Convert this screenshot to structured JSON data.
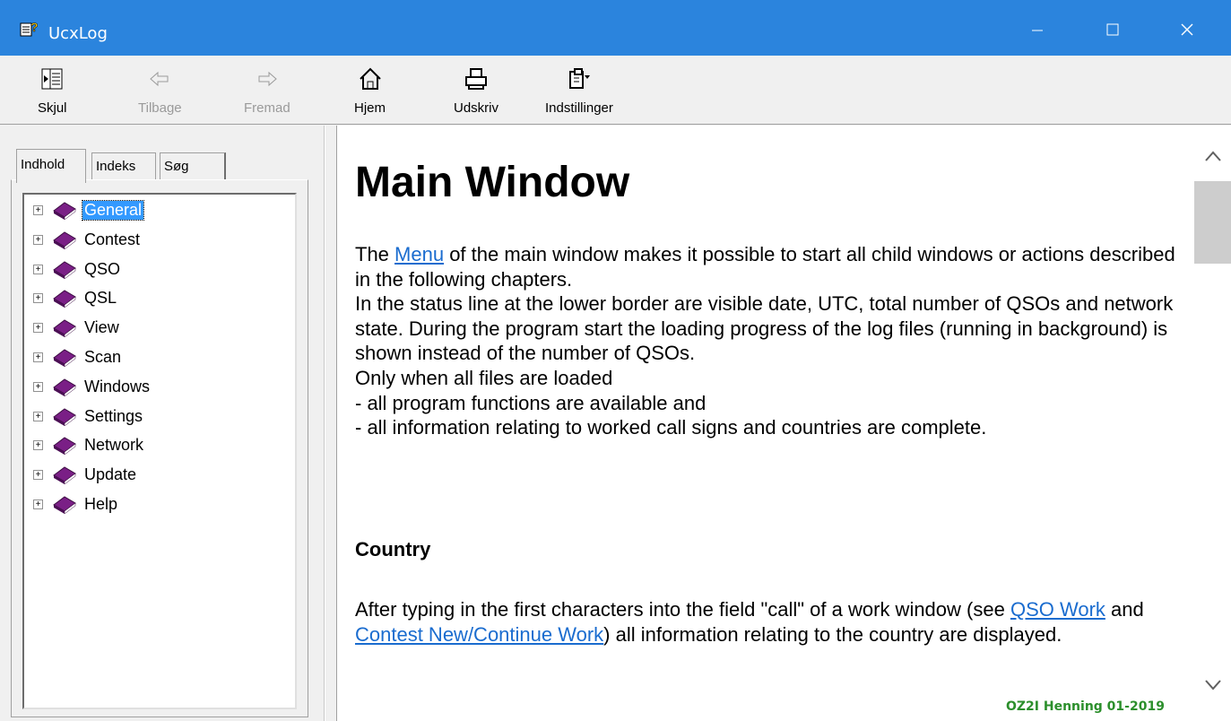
{
  "window": {
    "title": "UcxLog"
  },
  "toolbar": {
    "hide": "Skjul",
    "back": "Tilbage",
    "forward": "Fremad",
    "home": "Hjem",
    "print": "Udskriv",
    "options": "Indstillinger"
  },
  "tabs": {
    "contents": "Indhold",
    "index": "Indeks",
    "search": "Søg"
  },
  "tree": {
    "items": [
      {
        "label": "General",
        "selected": true
      },
      {
        "label": "Contest"
      },
      {
        "label": "QSO"
      },
      {
        "label": "QSL"
      },
      {
        "label": "View"
      },
      {
        "label": "Scan"
      },
      {
        "label": "Windows"
      },
      {
        "label": "Settings"
      },
      {
        "label": "Network"
      },
      {
        "label": "Update"
      },
      {
        "label": "Help"
      }
    ]
  },
  "content": {
    "title": "Main Window",
    "p1_pre": "The ",
    "p1_link": "Menu",
    "p1_post": " of the main window makes it possible to start all child windows or actions described in the following chapters.",
    "p2": "In the status line at the lower border are visible date, UTC, total number of QSOs and network state. During the program start the loading progress of the log files (running in background) is shown instead of the number of QSOs.",
    "p3": "Only when all files are loaded",
    "p4": "- all program functions are available and",
    "p5": "- all information relating to worked call signs and countries are complete.",
    "country_heading": "Country",
    "c_pre": "After typing in the first characters into the field \"call\" of a work window (see ",
    "c_link1": "QSO Work",
    "c_mid": " and ",
    "c_link2": "Contest New/Continue Work",
    "c_post": ") all information relating to the country are displayed.",
    "signature": "OZ2I Henning 01-2019"
  },
  "colors": {
    "titlebar": "#2b84dd",
    "link": "#1a6ccf",
    "book": "#7a1f86",
    "signature": "#2c8f2c",
    "selection": "#3399ff"
  }
}
